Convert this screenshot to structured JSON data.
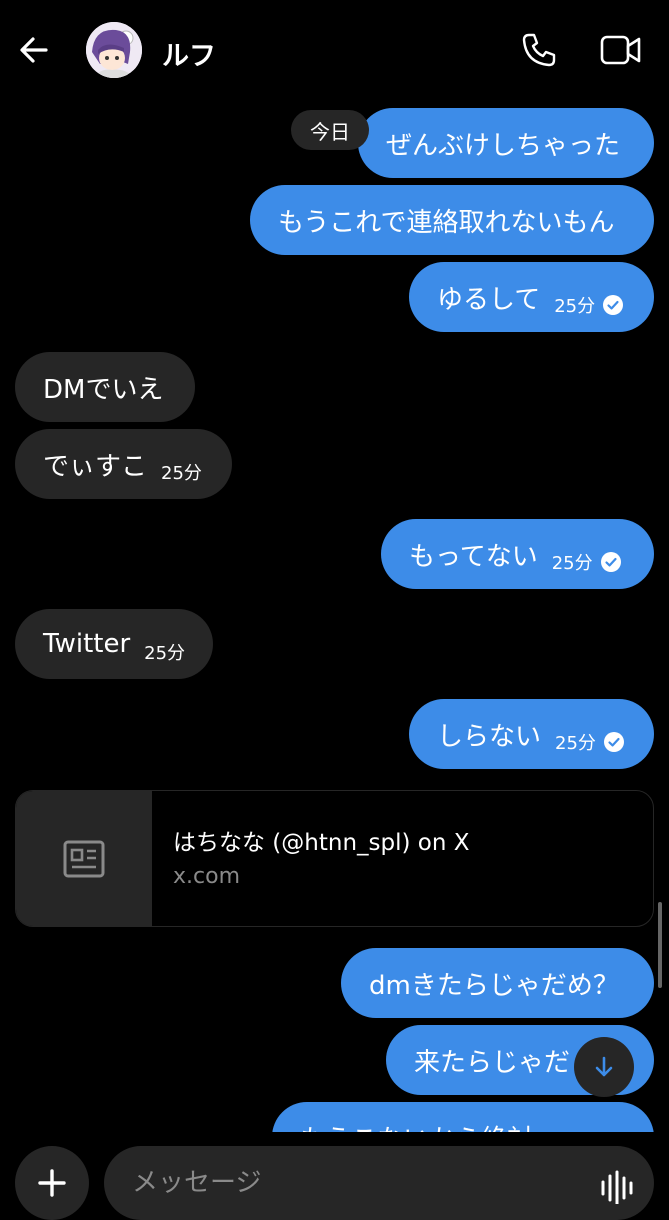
{
  "header": {
    "contact_name": "ルフ",
    "back_icon": "arrow-left-icon",
    "call_icon": "phone-icon",
    "video_icon": "video-camera-icon"
  },
  "date_divider": "今日",
  "messages": [
    {
      "side": "sent",
      "text": "ぜんぶけしちゃった"
    },
    {
      "side": "sent",
      "text": "もうこれで連絡取れないもん"
    },
    {
      "side": "sent",
      "text": "ゆるして",
      "time": "25分",
      "read": true
    },
    {
      "side": "received",
      "text": "DMでいえ"
    },
    {
      "side": "received",
      "text": "でぃすこ",
      "time": "25分"
    },
    {
      "side": "sent",
      "text": "もってない",
      "time": "25分",
      "read": true
    },
    {
      "side": "received",
      "text": "Twitter",
      "time": "25分"
    },
    {
      "side": "sent",
      "text": "しらない",
      "time": "25分",
      "read": true
    },
    {
      "side": "received",
      "type": "link",
      "title": "はちなな (@htnn_spl) on X",
      "domain": "x.com",
      "icon": "newspaper-icon"
    },
    {
      "side": "sent",
      "text": "dmきたらじゃだめ？"
    },
    {
      "side": "sent",
      "text": "来たらじゃだ"
    },
    {
      "side": "sent",
      "text": "もうこないから絶対"
    }
  ],
  "composer": {
    "placeholder": "メッセージ",
    "plus_icon": "plus-icon",
    "mic_icon": "audio-wave-icon"
  },
  "scroll_down_icon": "arrow-down-icon",
  "colors": {
    "background": "#000000",
    "sent_bubble": "#3d8ce8",
    "received_bubble": "#262626",
    "secondary_text": "#8a8a8a"
  }
}
